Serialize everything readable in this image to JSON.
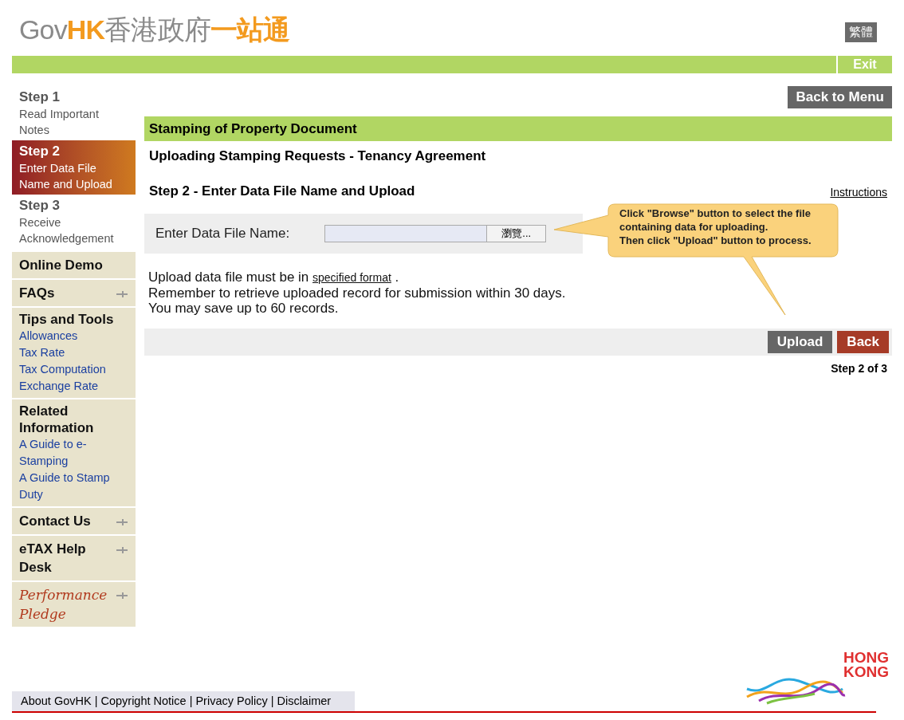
{
  "header": {
    "logo": [
      {
        "text": "Gov",
        "kind": "grey"
      },
      {
        "text": "HK",
        "kind": "orange"
      },
      {
        "text": "香港政府",
        "kind": "grey"
      },
      {
        "text": "一站通",
        "kind": "orange"
      }
    ],
    "language_button": "繁體",
    "exit_button": "Exit"
  },
  "sidebar": {
    "steps": [
      {
        "title": "Step 1",
        "label": "Read Important Notes",
        "selected": false
      },
      {
        "title": "Step 2",
        "label": "Enter Data File Name and Upload",
        "selected": true
      },
      {
        "title": "Step 3",
        "label": "Receive Acknowledgement",
        "selected": false
      }
    ],
    "menu": [
      {
        "kind": "plain",
        "title": "Online Demo"
      },
      {
        "kind": "expand",
        "title": "FAQs"
      },
      {
        "kind": "links",
        "title": "Tips and Tools",
        "links": [
          "Allowances",
          "Tax Rate",
          "Tax Computation",
          "Exchange Rate"
        ]
      },
      {
        "kind": "links",
        "title": "Related Information",
        "links": [
          "A Guide to e-Stamping",
          "A Guide to Stamp Duty"
        ]
      },
      {
        "kind": "expand",
        "title": "Contact Us"
      },
      {
        "kind": "expand",
        "title": "eTAX Help Desk"
      },
      {
        "kind": "script",
        "title": "Performance Pledge"
      }
    ]
  },
  "main": {
    "back_to_menu": "Back to Menu",
    "section_title": "Stamping of Property Document",
    "subtitle": "Uploading Stamping Requests - Tenancy Agreement",
    "step_heading": "Step 2 - Enter Data File Name and Upload",
    "instructions_link": "Instructions",
    "file_label": "Enter Data File Name:",
    "browse_button": "瀏覽...",
    "callout": "Click \"Browse\" button to select the file containing data for uploading.\nThen click \"Upload\" button to process.",
    "notes": [
      {
        "before": "Upload data file must be in ",
        "link": "specified format",
        "after": " ."
      },
      {
        "before": "Remember to retrieve uploaded record for submission within 30 days."
      },
      {
        "before": "You may save up to 60 records."
      }
    ],
    "upload_button": "Upload",
    "back_button": "Back",
    "step_indicator": "Step 2 of 3"
  },
  "footer": {
    "links": [
      "About GovHK",
      "Copyright Notice",
      "Privacy Policy",
      "Disclaimer"
    ],
    "separator": "|",
    "brand_logo": [
      "HONG",
      "KONG"
    ]
  }
}
